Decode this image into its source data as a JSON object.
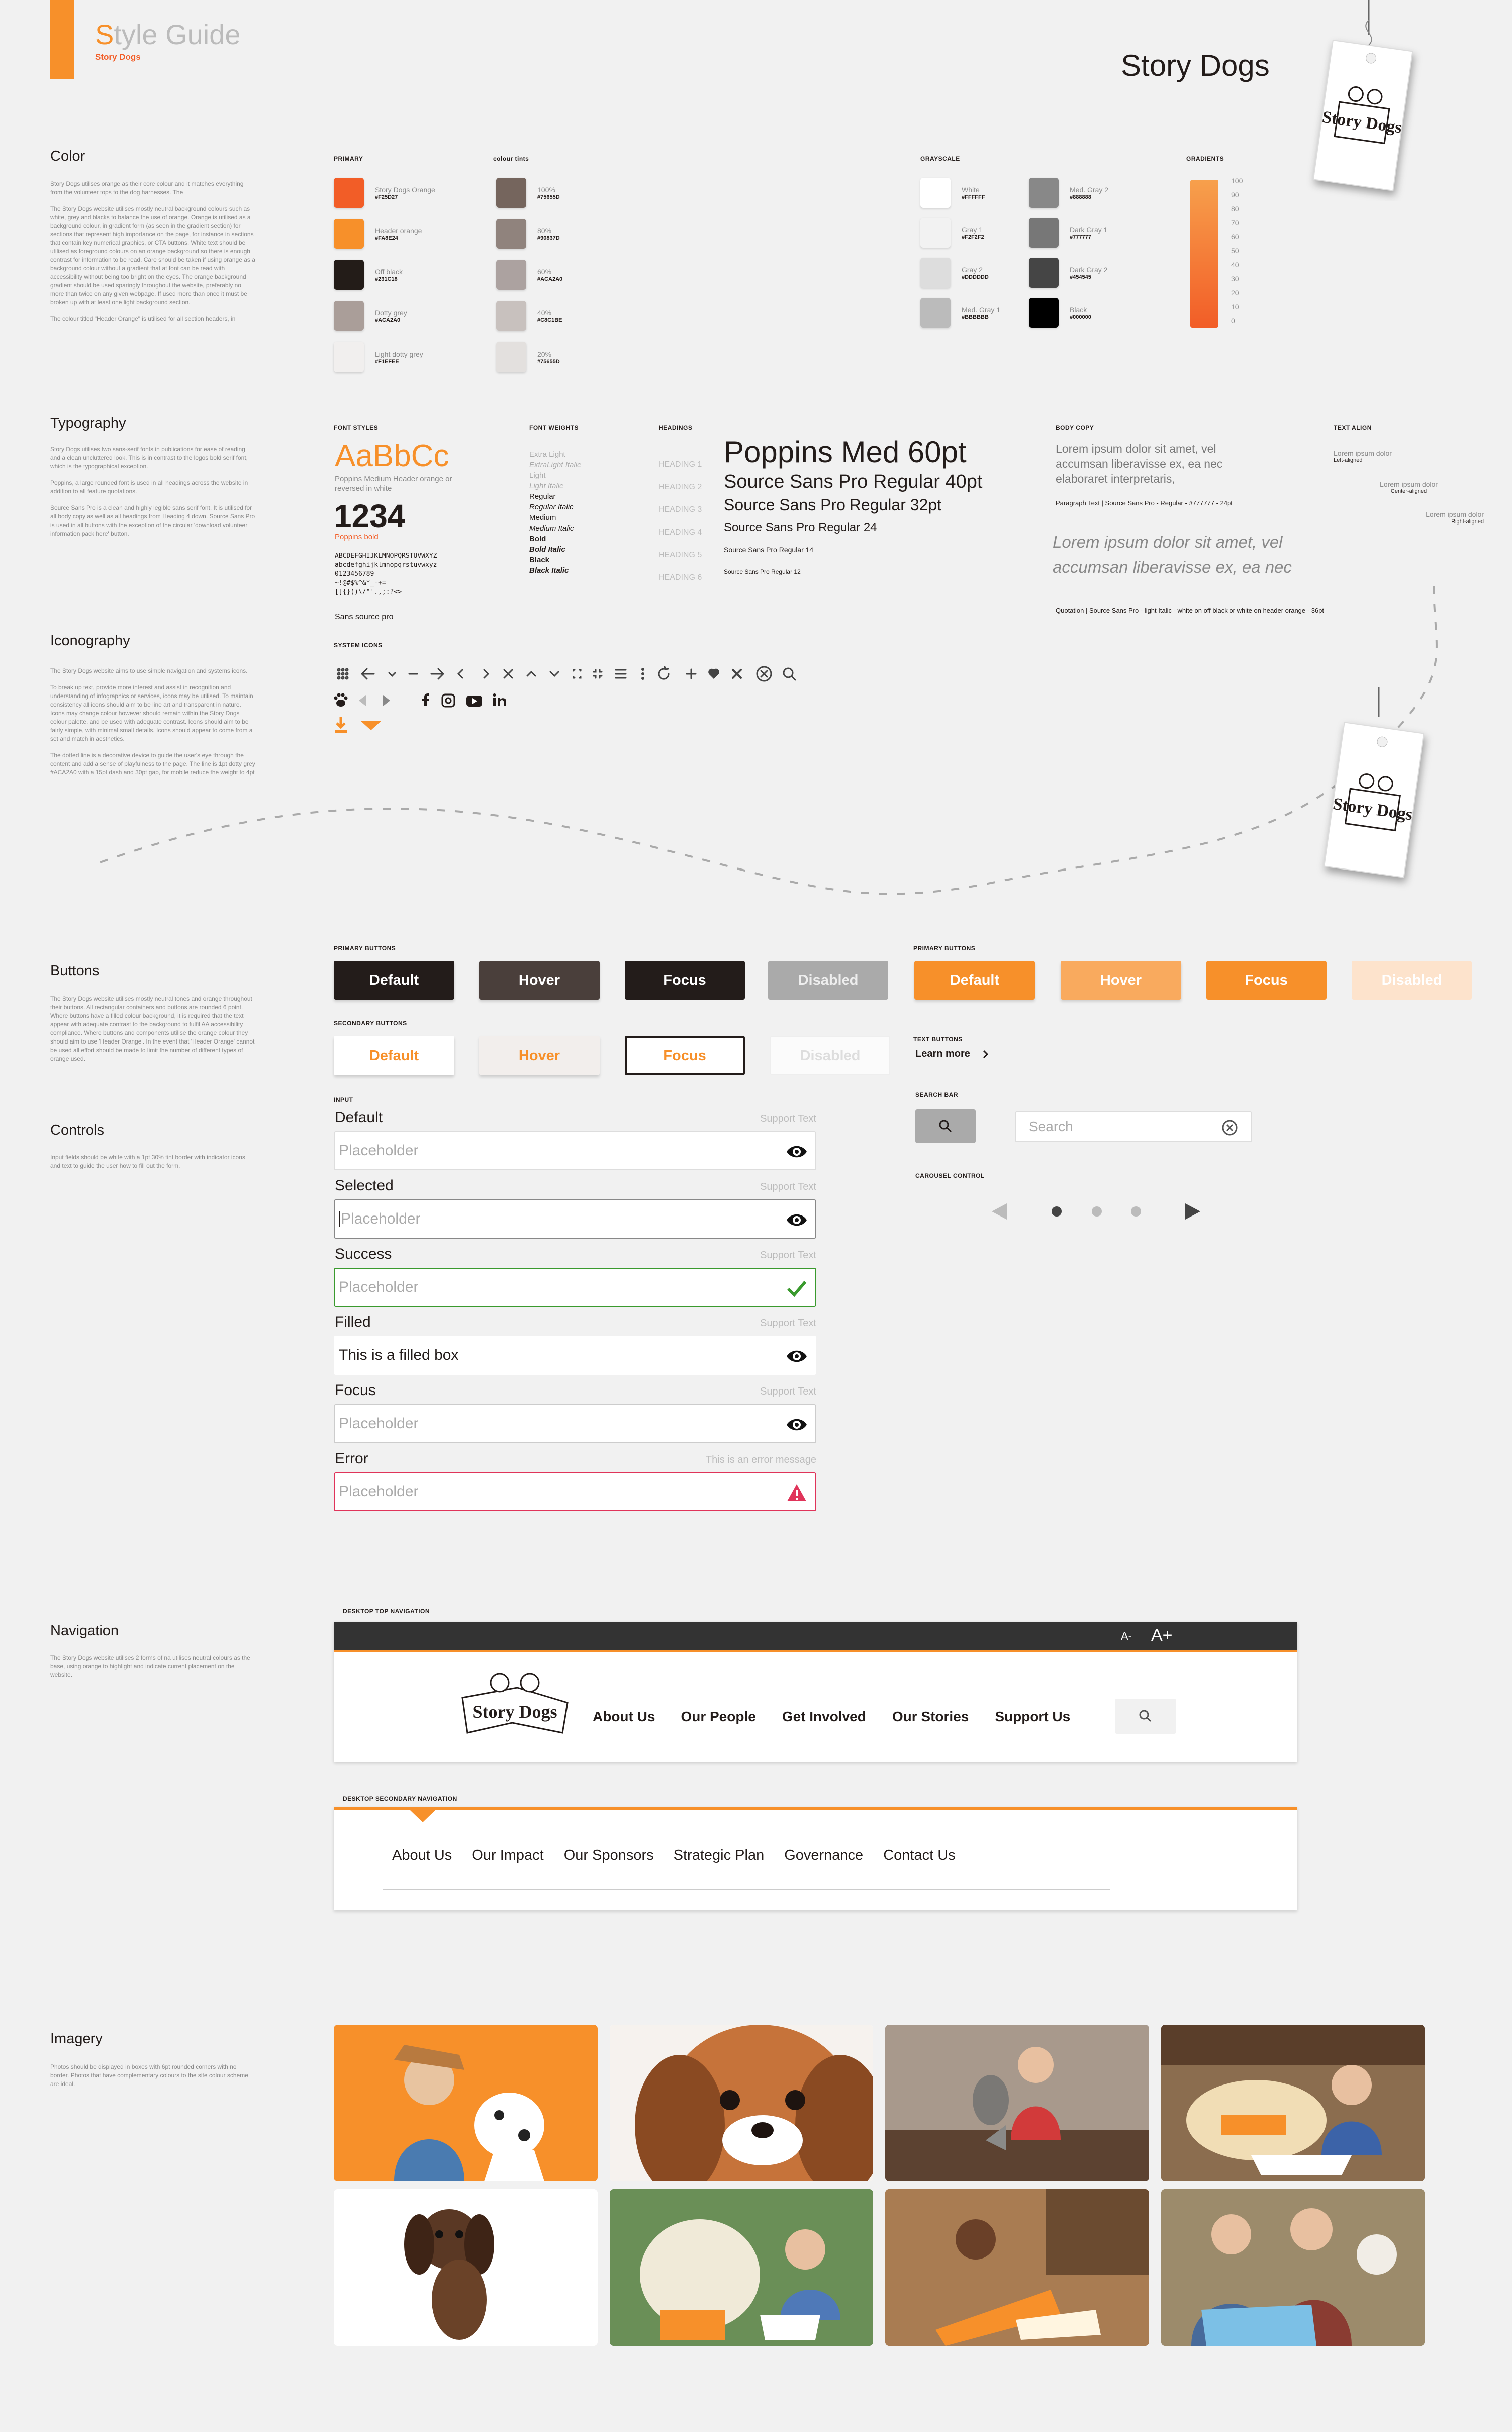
{
  "header": {
    "title_prefix": "S",
    "title_rest": "tyle Guide",
    "subtitle": "Story Dogs",
    "brand": "Story Dogs",
    "tag_text": "Story Dogs"
  },
  "colors": {
    "orange": "#F25D27",
    "header_orange": "#F8E24",
    "off_black": "#231C18",
    "accent": "#F2862C"
  },
  "color_section": {
    "title": "Color",
    "desc": [
      "Story Dogs utilises orange as their core colour and it matches everything from the volunteer tops to the dog harnesses. The",
      "The Story Dogs website utilises mostly neutral background colours such as white, grey and blacks to balance the use of orange. Orange is utilised as a background colour, in gradient form (as seen in the gradient section) for sections that represent high importance on the page, for instance in sections that contain key numerical graphics, or CTA buttons. White text should be utilised as foreground colours on an orange background so there is enough contrast for information to be read. Care should be taken if using orange as a background colour without a gradient that at font can be read with accessibility without being too bright on the eyes. The orange background gradient should be used sparingly throughout the website, preferably no more than twice on any given webpage. If used more than once it must be broken up with at least one light background section.",
      "The colour titled \"Header Orange\" is utilised for all section headers, in"
    ],
    "primary_label": "PRIMARY",
    "tints_label": "colour tints",
    "grayscale_label": "GRAYSCALE",
    "gradients_label": "GRADIENTS",
    "primary": [
      {
        "name": "Story Dogs Orange",
        "hex": "#F25D27",
        "color": "#F25D27"
      },
      {
        "name": "Header orange",
        "hex": "#FA8E24",
        "color": "#F7902A"
      },
      {
        "name": "Off black",
        "hex": "#231C18",
        "color": "#231C18"
      },
      {
        "name": "Dotty grey",
        "hex": "#ACA2A0",
        "color": "#AA9E99"
      },
      {
        "name": "Light dotty grey",
        "hex": "#F1EFEE",
        "color": "#F1EFEE"
      }
    ],
    "tints": [
      {
        "name": "100%",
        "hex": "#75655D",
        "color": "#75655D"
      },
      {
        "name": "80%",
        "hex": "#90837D",
        "color": "#90837D"
      },
      {
        "name": "60%",
        "hex": "#ACA2A0",
        "color": "#ACA2A0"
      },
      {
        "name": "40%",
        "hex": "#C8C1BE",
        "color": "#C8C1BE"
      },
      {
        "name": "20%",
        "hex": "#75655D",
        "color": "#E3E0DE"
      }
    ],
    "grayscale_a": [
      {
        "name": "White",
        "hex": "#FFFFFF",
        "color": "#FFFFFF"
      },
      {
        "name": "Gray 1",
        "hex": "#F2F2F2",
        "color": "#F2F2F2"
      },
      {
        "name": "Gray 2",
        "hex": "#DDDDDD",
        "color": "#DDDDDD"
      },
      {
        "name": "Med. Gray 1",
        "hex": "#BBBBBB",
        "color": "#BBBBBB"
      }
    ],
    "grayscale_b": [
      {
        "name": "Med. Gray 2",
        "hex": "#888888",
        "color": "#888888"
      },
      {
        "name": "Dark Gray 1",
        "hex": "#777777",
        "color": "#777777"
      },
      {
        "name": "Dark Gray 2",
        "hex": "#454545",
        "color": "#454545"
      },
      {
        "name": "Black",
        "hex": "#000000",
        "color": "#000000"
      }
    ],
    "gradient_ticks": [
      "100",
      "90",
      "80",
      "70",
      "60",
      "50",
      "40",
      "30",
      "20",
      "10",
      "0"
    ]
  },
  "typography": {
    "title": "Typography",
    "desc": [
      "Story Dogs utilises two sans-serif fonts in publications for ease of reading and a clean uncluttered look. This is in contrast to the logos bold serif font, which is the typographical exception.",
      "Poppins, a large rounded font is used in all headings across the website in addition to all feature quotations.",
      "Source Sans Pro is a clean and highly legible sans serif font. It is utilised for all body copy as well as all headings from Heading 4 down. Source Sans Pro is used in all buttons with the exception of the circular 'download volunteer information pack here' button."
    ],
    "font_styles_label": "FONT STYLES",
    "font_weights_label": "FONT WEIGHTS",
    "headings_label": "HEADINGS",
    "body_copy_label": "BODY COPY",
    "text_align_label": "TEXT ALIGN",
    "sample_big": "AaBbCc",
    "sample_note": "Poppins Medium Header orange or reversed in white",
    "number_sample": "1234",
    "number_note": "Poppins bold",
    "alphabet_upper": "ABCDEFGHIJKLMNOPQRSTUVWXYZ",
    "alphabet_lower": "abcdefghijklmnopqrstuvwxyz",
    "digits": "0123456789",
    "symbols": "~!@#$%^&*_-+=",
    "brackets": "[]{}()\\/\"'.,;:?<>",
    "sans_note": "Sans source pro",
    "weights": [
      "Extra Light",
      "ExtraLight Italic",
      "Light",
      "Light Italic",
      "Regular",
      "Regular Italic",
      "Medium",
      "Medium Italic",
      "Bold",
      "Bold Italic",
      "Black",
      "Black Italic"
    ],
    "headings": [
      "HEADING 1",
      "HEADING 2",
      "HEADING 3",
      "HEADING 4",
      "HEADING 5",
      "HEADING 6"
    ],
    "heading_samples": [
      "Poppins Med 60pt",
      "Source Sans Pro Regular 40pt",
      "Source Sans Pro Regular 32pt",
      "Source Sans Pro Regular 24",
      "Source Sans Pro Regular 14",
      "Source Sans Pro Regular 12"
    ],
    "body_text": "Lorem ipsum dolor sit amet, vel accumsan liberavisse ex, ea nec elaboraret interpretaris,",
    "body_note": "Paragraph Text | Source Sans Pro - Regular - #777777 - 24pt",
    "quote_text": "Lorem ipsum dolor sit amet, vel accumsan liberavisse ex, ea nec",
    "quote_note": "Quotation | Source Sans Pro - light Italic - white on off black or white on header orange - 36pt",
    "align_left": "Lorem ipsum dolor",
    "align_left_note": "Left-aligned",
    "align_center": "Lorem ipsum dolor",
    "align_center_note": "Center-aligned",
    "align_right": "Lorem ipsum dolor",
    "align_right_note": "Right-aligned"
  },
  "iconography": {
    "title": "Iconography",
    "desc": [
      "The Story Dogs website aims to use simple navigation and systems icons.",
      "To break up text, provide more interest and assist in recognition and understanding of infographics or services, icons may be utilised. To maintain consistency all icons should aim to be line art and transparent in nature. Icons may change colour however should remain within the Story Dogs colour palette, and be used with adequate contrast. Icons should aim to be fairly simple, with minimal small details. Icons should appear to come from a set and match in aesthetics.",
      "The dotted line is a decorative device to guide the user's eye through the content and add a sense of playfulness to the page. The line is 1pt dotty grey #ACA2A0 with a 15pt dash and 30pt gap, for mobile reduce the weight to 4pt"
    ],
    "system_icons_label": "SYSTEM ICONS",
    "icons": [
      "grid-icon",
      "arrow-left-icon",
      "chevron-down-icon",
      "dash-icon",
      "arrow-right-icon",
      "chevron-left-icon",
      "chevron-right-icon",
      "close-icon",
      "chevron-up-icon",
      "chevron-down-icon",
      "expand-icon",
      "shrink-icon",
      "menu-icon",
      "more-icon",
      "refresh-icon",
      "plus-icon",
      "heart-icon",
      "close-bold-icon",
      "close-circle-icon",
      "search-icon"
    ]
  },
  "buttons": {
    "title": "Buttons",
    "desc": "The Story Dogs website utilises mostly neutral tones and orange throughout their buttons. All rectangular containers and buttons are rounded 6 point. Where buttons have a filled colour background, it is required that the text appear with adequate contrast to the background to fulfil AA accessibility compliance. Where buttons and components utilise the orange colour they should aim to use 'Header Orange'. In the event that 'Header Orange' cannot be used all effort should be made to limit the number of different types of orange used.",
    "primary_label": "PRIMARY BUTTONS",
    "secondary_label": "SECONDARY BUTTONS",
    "text_buttons_label": "TEXT BUTTONS",
    "states": [
      "Default",
      "Hover",
      "Focus",
      "Disabled"
    ],
    "learn_more": "Learn more"
  },
  "controls": {
    "title": "Controls",
    "desc": "Input fields should be white with a 1pt 30% tint border with indicator icons and text to guide the user how to fill out the form.",
    "input_label": "INPUT",
    "search_bar_label": "SEARCH BAR",
    "carousel_label": "CAROUSEL CONTROL",
    "search_placeholder": "Search",
    "fields": [
      {
        "label": "Default",
        "support": "Support Text",
        "value": "Placeholder"
      },
      {
        "label": "Selected",
        "support": "Support Text",
        "value": "Placeholder"
      },
      {
        "label": "Success",
        "support": "Support Text",
        "value": "Placeholder"
      },
      {
        "label": "Filled",
        "support": "Support Text",
        "value": "This is a filled box"
      },
      {
        "label": "Focus",
        "support": "Support Text",
        "value": "Placeholder"
      },
      {
        "label": "Error",
        "support": "This is an error message",
        "value": "Placeholder"
      }
    ]
  },
  "navigation": {
    "title": "Navigation",
    "desc": "The Story Dogs website utilises 2 forms of na utilises neutral colours as the base, using orange to highlight and indicate current placement on the website.",
    "top_label": "DESKTOP TOP NAVIGATION",
    "secondary_label": "DESKTOP SECONDARY NAVIGATION",
    "font_small": "A-",
    "font_large": "A+",
    "main_items": [
      "About Us",
      "Our People",
      "Get Involved",
      "Our Stories",
      "Support Us"
    ],
    "sub_items": [
      "About Us",
      "Our Impact",
      "Our Sponsors",
      "Strategic Plan",
      "Governance",
      "Contact Us"
    ]
  },
  "imagery": {
    "title": "Imagery",
    "desc": "Photos should be displayed in boxes with 6pt rounded corners with no border. Photos that have complementary colours to the site colour scheme are ideal.",
    "tiles": [
      "girl-with-dalmatian-photo",
      "cavalier-spaniel-photo",
      "girl-with-whippet-photo",
      "boy-reading-with-labrador-photo",
      "dachshund-photo",
      "girl-with-golden-retriever-photo",
      "boy-reading-on-floor-photo",
      "children-with-volunteer-and-dog-photo"
    ]
  }
}
